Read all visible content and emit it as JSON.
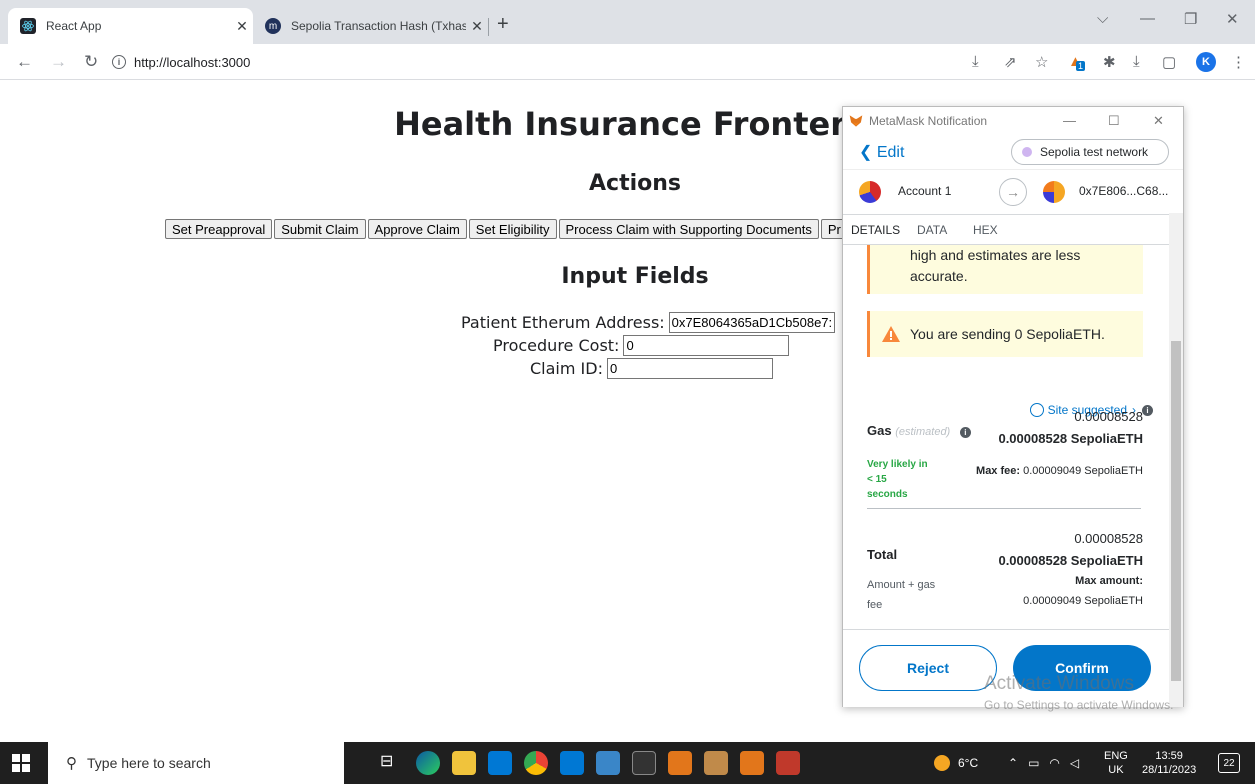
{
  "browser": {
    "tabs": [
      {
        "title": "React App",
        "active": true
      },
      {
        "title": "Sepolia Transaction Hash (Txhash",
        "active": false
      }
    ],
    "url": "http://localhost:3000",
    "profile_initial": "K",
    "extension_badge": "1"
  },
  "page": {
    "title": "Health Insurance Frontend",
    "actions_heading": "Actions",
    "action_buttons": [
      "Set Preapproval",
      "Submit Claim",
      "Approve Claim",
      "Set Eligibility",
      "Process Claim with Supporting Documents",
      "Pr"
    ],
    "inputs_heading": "Input Fields",
    "fields": {
      "patient_label": "Patient Etherum Address:",
      "patient_value": "0x7E8064365aD1Cb508e7:",
      "cost_label": "Procedure Cost:",
      "cost_value": "0",
      "claim_label": "Claim ID:",
      "claim_value": "0"
    }
  },
  "metamask": {
    "window_title": "MetaMask Notification",
    "edit_label": "Edit",
    "network": "Sepolia test network",
    "from_account": "Account 1",
    "to_address": "0x7E806...C68...",
    "tabs": [
      "DETAILS",
      "DATA",
      "HEX"
    ],
    "warning_partial": "high and estimates are less accurate.",
    "sending_warning": "You are sending 0 SepoliaETH.",
    "site_suggested": "Site suggested",
    "gas_label": "Gas",
    "gas_estimated": "(estimated)",
    "gas_amount": "0.00008528",
    "gas_amount_eth": "0.00008528 SepoliaETH",
    "likely_text": "Very likely in < 15 seconds",
    "max_fee_label": "Max fee:",
    "max_fee_value": "0.00009049 SepoliaETH",
    "total_label": "Total",
    "total_amount": "0.00008528",
    "total_amount_eth": "0.00008528 SepoliaETH",
    "amount_gas_label": "Amount + gas fee",
    "max_amount_label": "Max amount:",
    "max_amount_value": "0.00009049 SepoliaETH",
    "reject_label": "Reject",
    "confirm_label": "Confirm"
  },
  "watermark": {
    "line1": "Activate Windows",
    "line2": "Go to Settings to activate Windows."
  },
  "taskbar": {
    "search_placeholder": "Type here to search",
    "temperature": "6°C",
    "language": "ENG",
    "region": "UK",
    "time": "13:59",
    "date": "28/11/2023",
    "notifications": "22"
  },
  "colors": {
    "metamask_blue": "#0376c9",
    "warning_orange": "#f8883b",
    "likely_green": "#28a745"
  }
}
